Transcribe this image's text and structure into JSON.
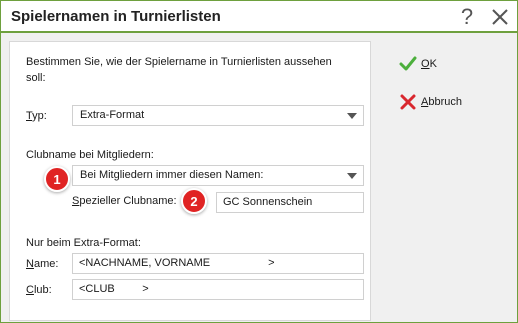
{
  "window": {
    "title": "Spielernamen in Turnierlisten"
  },
  "titlebar": {
    "help_glyph": "?",
    "close_icon": "close-icon"
  },
  "intro_text": "Bestimmen Sie, wie der Spielername in Turnierlisten aussehen soll:",
  "typ": {
    "label_mnemonic": "T",
    "label_rest": "yp:",
    "value": "Extra-Format"
  },
  "club_section": {
    "label": "Clubname bei Mitgliedern:",
    "combo_value": "Bei Mitgliedern immer diesen Namen:",
    "special_label_mnemonic": "S",
    "special_label_rest": "pezieller Clubname:",
    "special_value": "GC Sonnenschein"
  },
  "badges": [
    "1",
    "2"
  ],
  "extra_section": {
    "label": "Nur beim Extra-Format:",
    "name_mnemonic": "N",
    "name_rest": "ame:",
    "name_value": "<NACHNAME, VORNAME                   >",
    "club_mnemonic": "C",
    "club_rest": "lub:",
    "club_value": "<CLUB         >"
  },
  "buttons": {
    "ok_mnemonic": "O",
    "ok_rest": "K",
    "cancel_mnemonic": "A",
    "cancel_rest": "bbruch"
  },
  "colors": {
    "accent": "#6ea03e",
    "ok_check": "#4caf3c",
    "cancel_x": "#d9272e",
    "badge": "#e02323"
  }
}
